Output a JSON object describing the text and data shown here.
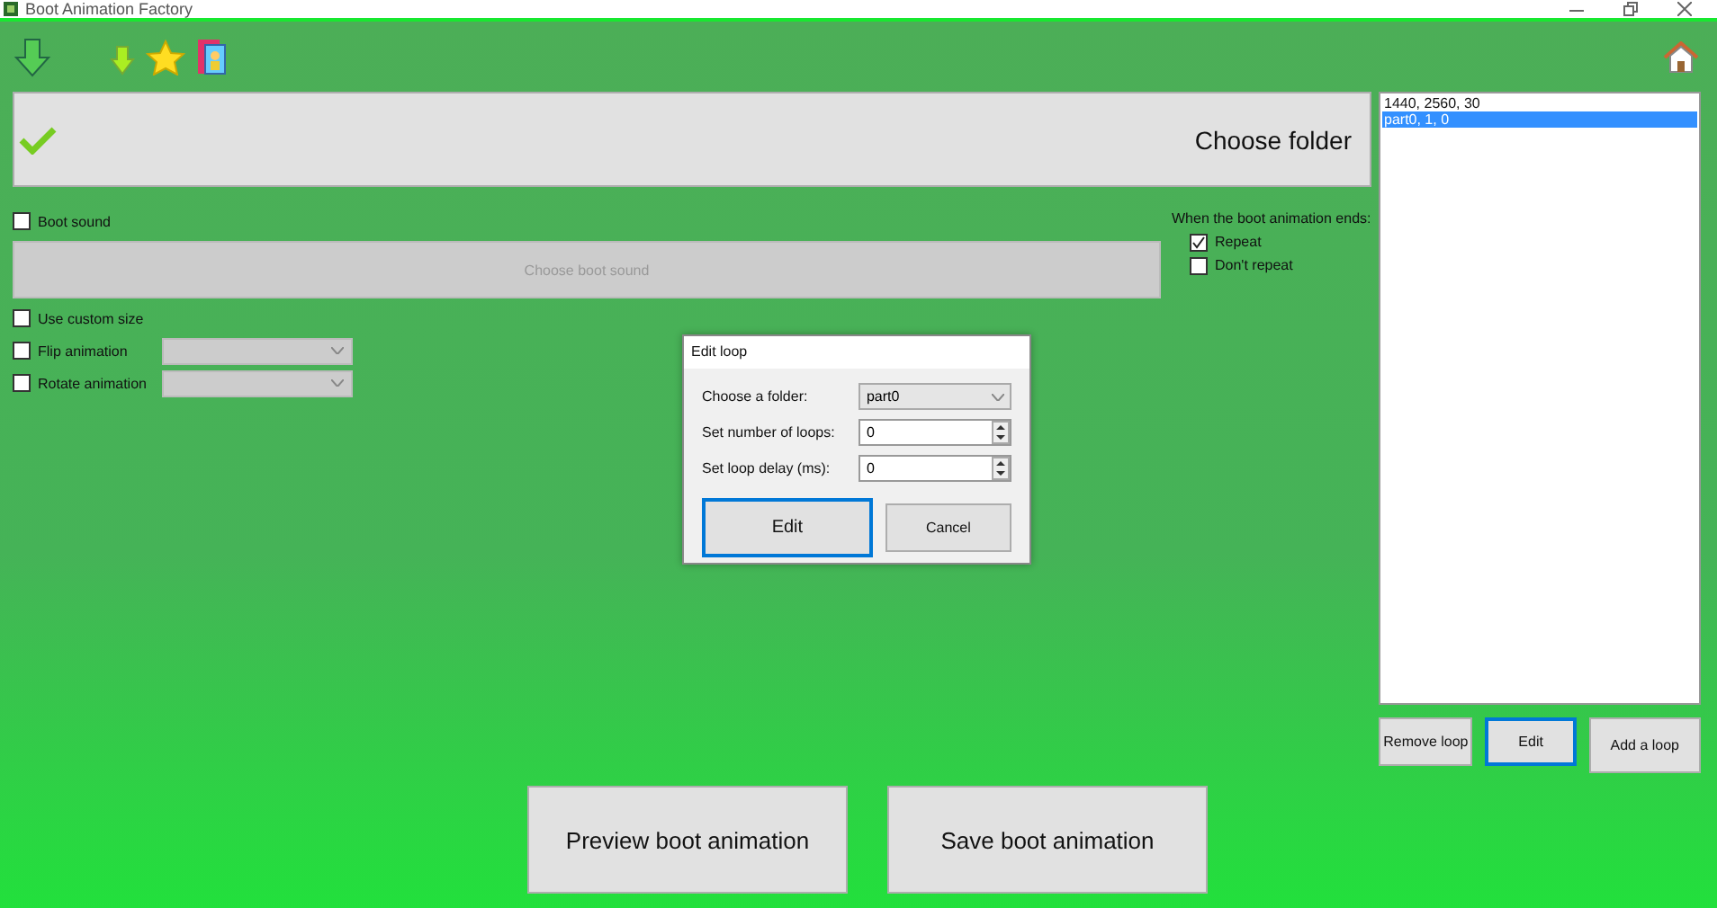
{
  "window": {
    "title": "Boot Animation Factory"
  },
  "choose_folder": {
    "label": "Choose folder"
  },
  "boot_sound": {
    "label": "Boot sound",
    "checked": false,
    "button": "Choose boot sound"
  },
  "end_options": {
    "heading": "When the boot animation ends:",
    "options": [
      {
        "label": "Repeat",
        "checked": true
      },
      {
        "label": "Don't repeat",
        "checked": false
      }
    ]
  },
  "options": [
    {
      "kind": "checkbox",
      "label": "Use custom size",
      "checked": false
    },
    {
      "kind": "dropdown",
      "label": "Flip animation",
      "checked": false
    },
    {
      "kind": "dropdown",
      "label": "Rotate animation",
      "checked": false
    }
  ],
  "loops": {
    "items": [
      {
        "text": "1440, 2560, 30",
        "selected": false
      },
      {
        "text": "part0, 1, 0",
        "selected": true
      }
    ],
    "buttons": [
      {
        "label": "Remove loop",
        "focused": false
      },
      {
        "label": "Edit",
        "focused": true
      },
      {
        "label": "Add a loop",
        "focused": false
      }
    ]
  },
  "actions": [
    "Preview boot animation",
    "Save boot animation"
  ],
  "dialog": {
    "title": "Edit loop",
    "fields": [
      {
        "kind": "dropdown",
        "label": "Choose a folder:",
        "value": "part0"
      },
      {
        "kind": "spinner",
        "label": "Set number of loops:",
        "value": "0"
      },
      {
        "kind": "spinner",
        "label": "Set loop delay (ms):",
        "value": "0"
      }
    ],
    "buttons": [
      {
        "label": "Edit",
        "focused": true
      },
      {
        "label": "Cancel",
        "focused": false
      }
    ]
  }
}
